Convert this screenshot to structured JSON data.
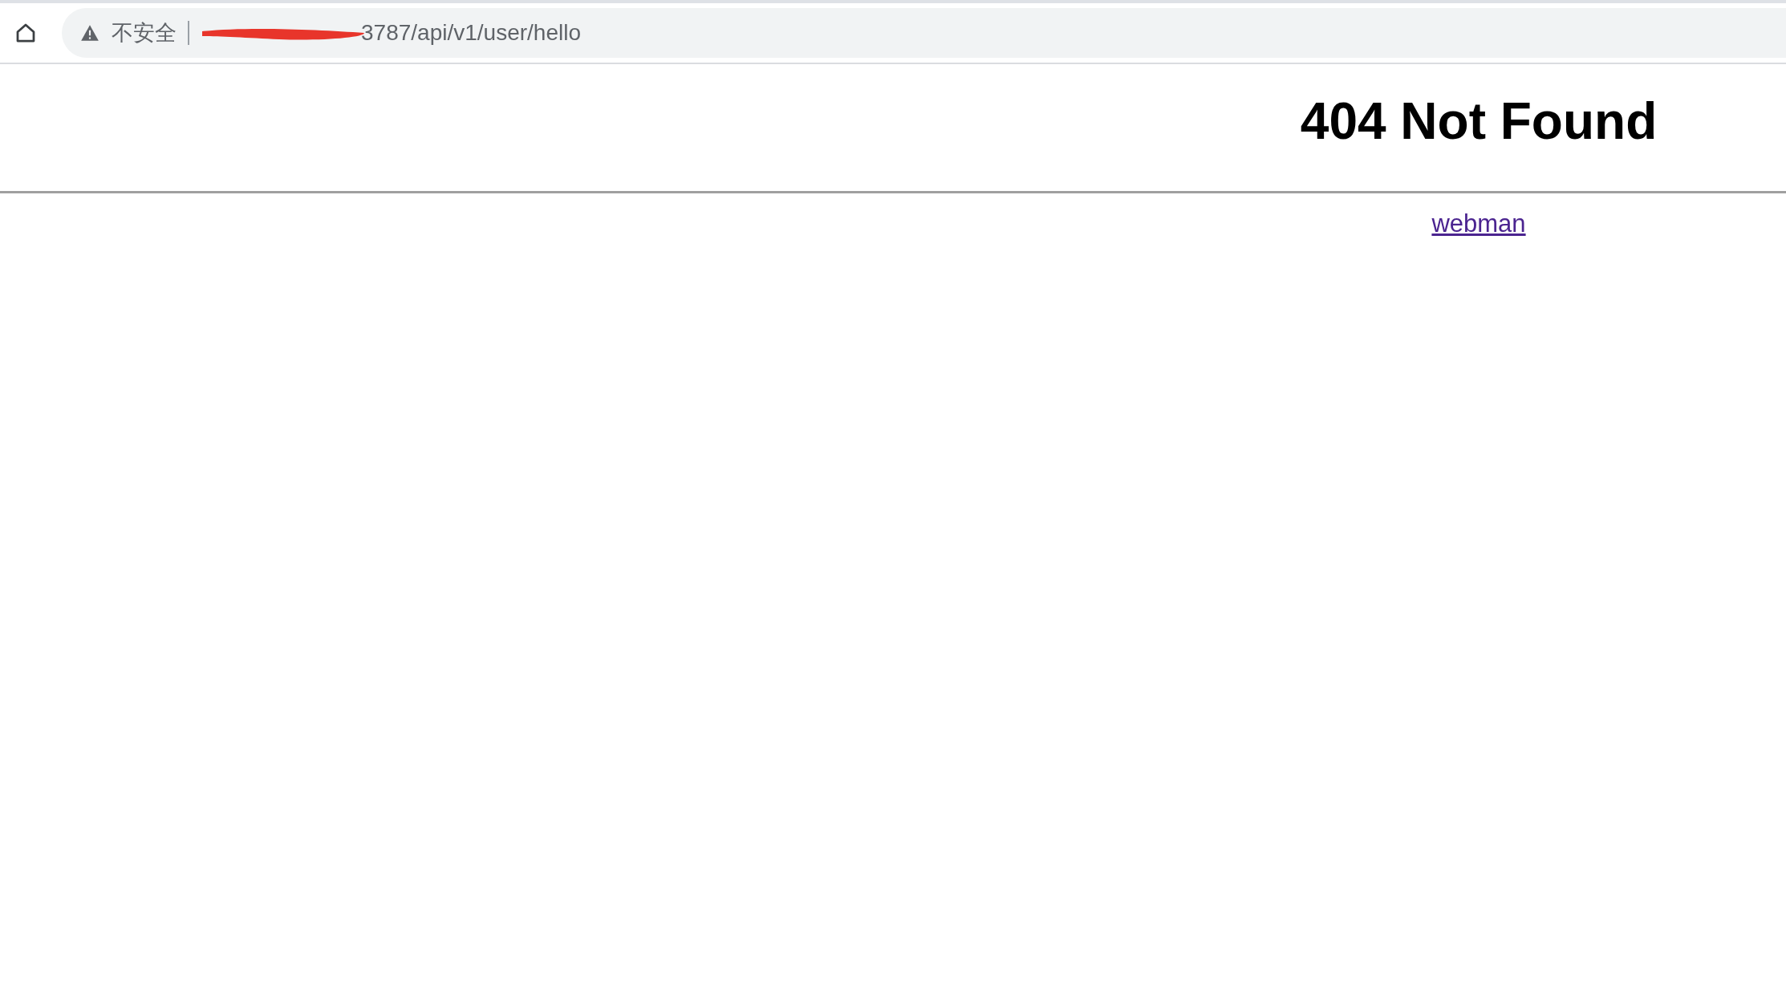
{
  "address_bar": {
    "security_label": "不安全",
    "url": "3787/api/v1/user/hello"
  },
  "page": {
    "heading": "404 Not Found",
    "link": "webman"
  }
}
